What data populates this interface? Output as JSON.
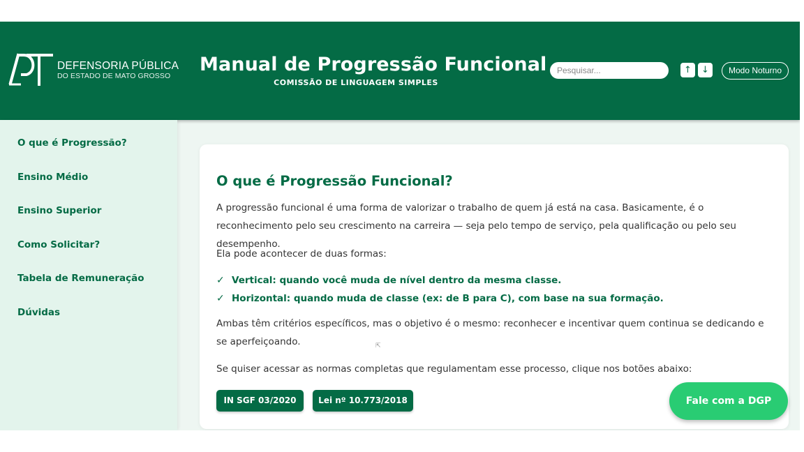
{
  "header": {
    "logo_name": "DEFENSORIA PÚBLICA",
    "logo_sub": "DO ESTADO DE MATO GROSSO",
    "title": "Manual de Progressão Funcional",
    "subtitle": "COMISSÃO DE LINGUAGEM SIMPLES",
    "search_placeholder": "Pesquisar...",
    "up_label": "↑",
    "down_label": "↓",
    "night_label": "Modo Noturno"
  },
  "sidebar": {
    "items": [
      {
        "label": "O que é Progressão?"
      },
      {
        "label": "Ensino Médio"
      },
      {
        "label": "Ensino Superior"
      },
      {
        "label": "Como Solicitar?"
      },
      {
        "label": "Tabela de Remuneração"
      },
      {
        "label": "Dúvidas"
      }
    ]
  },
  "main": {
    "heading": "O que é Progressão Funcional?",
    "intro": "A progressão funcional é uma forma de valorizar o trabalho de quem já está na casa. Basicamente, é o reconhecimento pelo seu crescimento na carreira — seja pelo tempo de serviço, pela qualificação ou pelo seu desempenho.",
    "forms_intro": "Ela pode acontecer de duas formas:",
    "forms": [
      {
        "check": "✓",
        "text": "Vertical: quando você muda de nível dentro da mesma classe."
      },
      {
        "check": "✓",
        "text": "Horizontal: quando muda de classe (ex: de B para C), com base na sua formação."
      }
    ],
    "objective": "Ambas têm critérios específicos, mas o objetivo é o mesmo: reconhecer e incentivar quem continua se dedicando e se aperfeiçoando.",
    "norms_intro": "Se quiser acessar as normas completas que regulamentam esse processo, clique nos botões abaixo:",
    "buttons": [
      {
        "label": "IN SGF 03/2020"
      },
      {
        "label": "Lei nº 10.773/2018"
      }
    ]
  },
  "fab": {
    "label": "Fale com a DGP"
  },
  "colors": {
    "primary": "#046b45",
    "fab": "#29cc73",
    "sidebar_bg": "#e3f4ec",
    "page_bg": "#eef6f2"
  }
}
